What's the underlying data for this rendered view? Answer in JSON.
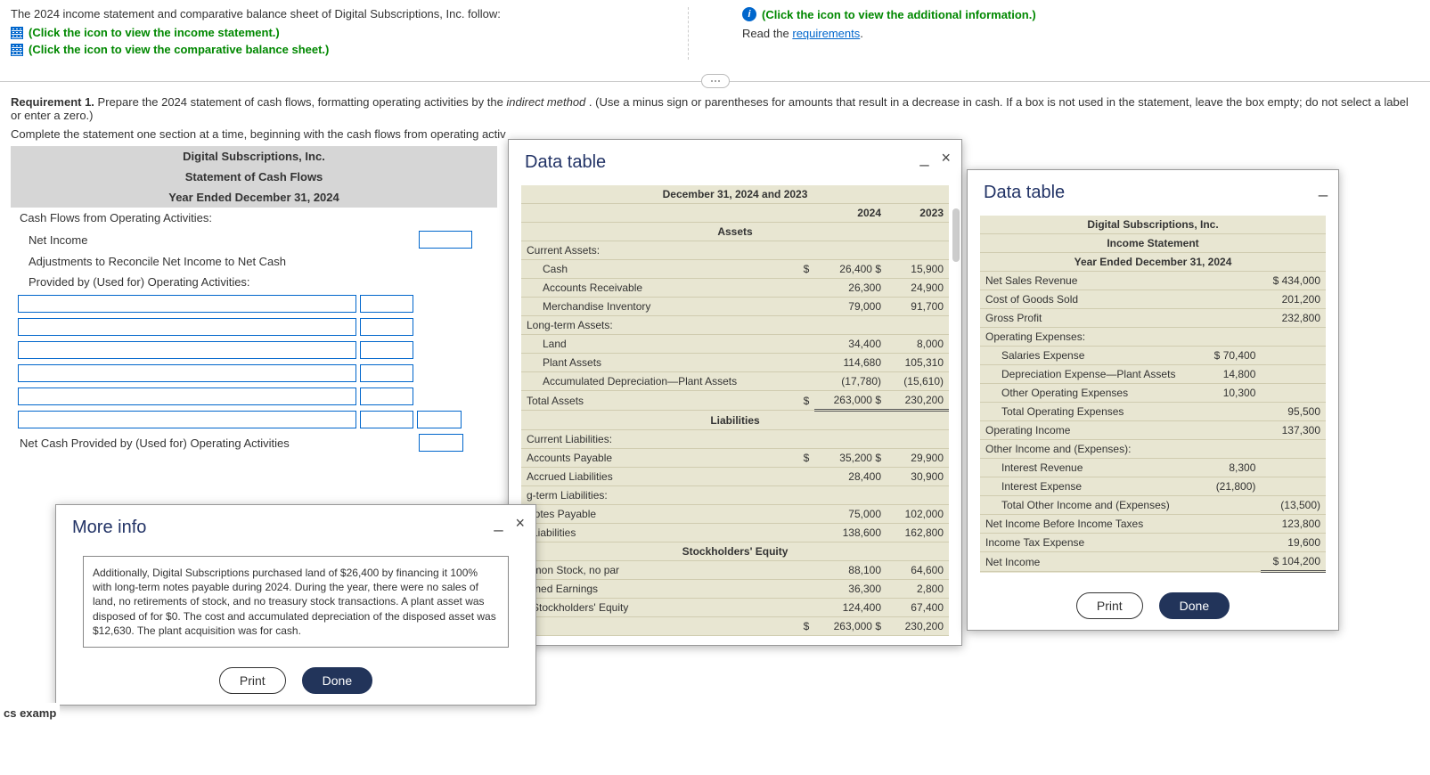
{
  "intro": {
    "line1": "The 2024 income statement and comparative balance sheet of Digital Subscriptions, Inc. follow:",
    "link_income": "(Click the icon to view the income statement.)",
    "link_bs": "(Click the icon to view the comparative balance sheet.)",
    "info_link": "(Click the icon to view the additional information.)",
    "read_the": "Read the ",
    "requirements": "requirements",
    "period": "."
  },
  "requirement": {
    "label": "Requirement 1.",
    "text_a": " Prepare the 2024 statement of cash flows, formatting operating activities by the ",
    "indirect": "indirect method",
    "text_b": ". (Use a minus sign or parentheses for amounts that result in a decrease in cash. If a box is not used in the statement, leave the box empty; do not select a label or enter a zero.)",
    "complete": "Complete the statement one section at a time, beginning with the cash flows from operating activ"
  },
  "worksheet": {
    "company": "Digital Subscriptions, Inc.",
    "title": "Statement of Cash Flows",
    "period": "Year Ended December 31, 2024",
    "sec1": "Cash Flows from Operating Activities:",
    "ni": "Net Income",
    "adj1": "Adjustments to Reconcile Net Income to Net Cash",
    "adj2": "Provided by (Used for) Operating Activities:",
    "netcash": "Net Cash Provided by (Used for) Operating Activities"
  },
  "moreinfo": {
    "title": "More info",
    "body": "Additionally, Digital Subscriptions purchased land of $26,400 by financing it 100% with long-term notes payable during 2024. During the year, there were no sales of land, no retirements of stock, and no treasury stock transactions. A plant asset was disposed of for $0. The cost and accumulated depreciation of the disposed asset was $12,630. The plant acquisition was for cash.",
    "print": "Print",
    "done": "Done"
  },
  "bs": {
    "title": "Data table",
    "period": "December 31, 2024 and 2023",
    "y1": "2024",
    "y2": "2023",
    "assets": "Assets",
    "ca": "Current Assets:",
    "cash": "Cash",
    "cash1": "26,400",
    "cash2": "15,900",
    "ar": "Accounts Receivable",
    "ar1": "26,300",
    "ar2": "24,900",
    "inv": "Merchandise Inventory",
    "inv1": "79,000",
    "inv2": "91,700",
    "lta": "Long-term Assets:",
    "land": "Land",
    "land1": "34,400",
    "land2": "8,000",
    "pa": "Plant Assets",
    "pa1": "114,680",
    "pa2": "105,310",
    "ad": "Accumulated Depreciation—Plant Assets",
    "ad1": "(17,780)",
    "ad2": "(15,610)",
    "ta": "Total Assets",
    "ta1": "263,000",
    "ta2": "230,200",
    "liab": "Liabilities",
    "cl": "Current Liabilities:",
    "ap": "Accounts Payable",
    "ap1": "35,200",
    "ap2": "29,900",
    "al": "Accrued Liabilities",
    "al1": "28,400",
    "al2": "30,900",
    "ltl": "g-term Liabilities:",
    "np": "Notes Payable",
    "np1": "75,000",
    "np2": "102,000",
    "tl": "l Liabilities",
    "tl1": "138,600",
    "tl2": "162,800",
    "se": "Stockholders' Equity",
    "cs": "nmon Stock, no par",
    "cs1": "88,100",
    "cs2": "64,600",
    "re": "ained Earnings",
    "re1": "36,300",
    "re2": "2,800",
    "tse": "l Stockholders' Equity",
    "tse1": "124,400",
    "tse2": "67,400",
    "tlse1": "263,000",
    "tlse2": "230,200",
    "print": "Print",
    "done": "Done"
  },
  "is": {
    "title": "Data table",
    "company": "Digital Subscriptions, Inc.",
    "stmt": "Income Statement",
    "period": "Year Ended December 31, 2024",
    "nsr": "Net Sales Revenue",
    "nsr_v": "434,000",
    "cogs": "Cost of Goods Sold",
    "cogs_v": "201,200",
    "gp": "Gross Profit",
    "gp_v": "232,800",
    "opex": "Operating Expenses:",
    "sal": "Salaries Expense",
    "sal_v": "70,400",
    "dep": "Depreciation Expense—Plant Assets",
    "dep_v": "14,800",
    "ooe": "Other Operating Expenses",
    "ooe_v": "10,300",
    "toe": "Total Operating Expenses",
    "toe_v": "95,500",
    "oi": "Operating Income",
    "oi_v": "137,300",
    "oie": "Other Income and (Expenses):",
    "ir": "Interest Revenue",
    "ir_v": "8,300",
    "ie": "Interest Expense",
    "ie_v": "(21,800)",
    "toie": "Total Other Income and (Expenses)",
    "toie_v": "(13,500)",
    "nibt": "Net Income Before Income Taxes",
    "nibt_v": "123,800",
    "ite": "Income Tax Expense",
    "ite_v": "19,600",
    "ni": "Net Income",
    "ni_v": "104,200",
    "print": "Print",
    "done": "Done"
  },
  "footer_tag": "cs examp",
  "minimize": "_",
  "close": "×",
  "dollar": "$"
}
